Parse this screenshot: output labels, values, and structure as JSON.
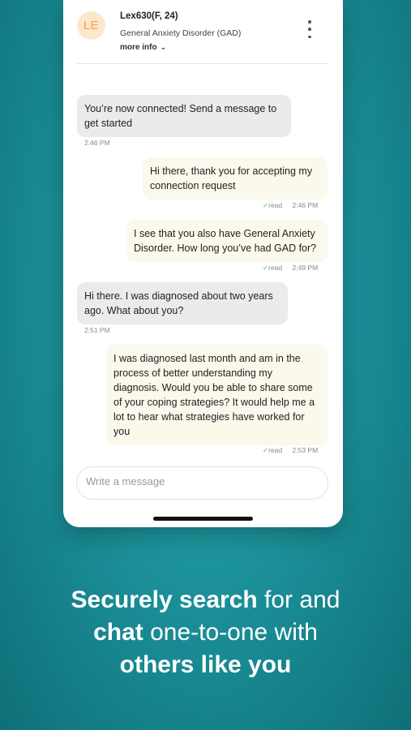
{
  "header": {
    "avatar_initials": "LE",
    "user_name": "Lex630(F, 24)",
    "condition": "General Anxiety Disorder (GAD)",
    "more_info": "more info",
    "chevron": "⌄"
  },
  "messages": [
    {
      "direction": "in",
      "text": "You’re now connected! Send a message to get started",
      "time": "2:46 PM"
    },
    {
      "direction": "out",
      "text": "Hi there, thank you for accepting my connection request",
      "status": "read",
      "time": "2:46 PM"
    },
    {
      "direction": "out",
      "text": "I see that you also have General Anxiety Disorder. How long you’ve had GAD for?",
      "status": "read",
      "time": "2:49 PM"
    },
    {
      "direction": "in",
      "text": "Hi there. I was diagnosed about two years ago. What about you?",
      "time": "2:51 PM"
    },
    {
      "direction": "out",
      "text": "I was diagnosed last month and am in the process of better understanding my diagnosis. Would you be able to share some of your coping strategies? It would help me a lot to hear what strategies have worked for you",
      "status": "read",
      "time": "2:53 PM"
    }
  ],
  "composer": {
    "placeholder": "Write a message"
  },
  "tagline": {
    "line1_bold": "Securely search",
    "line1_rest": " for and",
    "line2_bold": "chat",
    "line2_rest": " one-to-one with",
    "line3_bold": "others like you"
  },
  "colors": {
    "background": "#1b8f98",
    "avatar_bg": "#fde7cc",
    "avatar_text": "#f0a24f",
    "incoming_bubble": "#ebebeb",
    "outgoing_bubble": "#fbf8ec",
    "read_check": "#4caf73"
  },
  "icons": {
    "status_check": "✓",
    "menu": "kebab-menu-icon"
  }
}
